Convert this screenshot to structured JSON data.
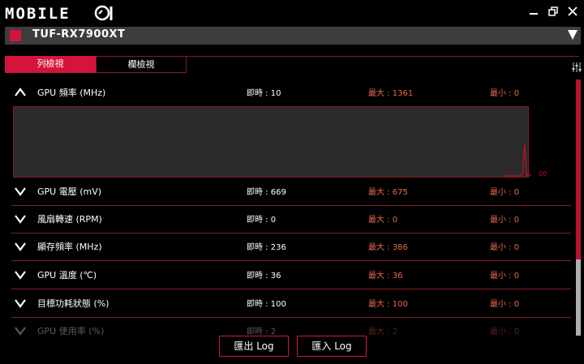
{
  "app": {
    "logo_text": "MOBILE01"
  },
  "device": {
    "name": "TUF-RX7900XT"
  },
  "tabs": [
    {
      "label": "列檢視"
    },
    {
      "label": "欄檢視"
    }
  ],
  "sensors": [
    {
      "label": "GPU 頻率 (MHz)",
      "current": "即時 : 10",
      "max": "最大 : 1361",
      "min": "最小 : 0",
      "expanded": true
    },
    {
      "label": "GPU 電壓 (mV)",
      "current": "即時 : 669",
      "max": "最大 : 675",
      "min": "最小 : 0"
    },
    {
      "label": "風扇轉速 (RPM)",
      "current": "即時 : 0",
      "max": "最大 : 0",
      "min": "最小 : 0"
    },
    {
      "label": "顯存頻率 (MHz)",
      "current": "即時 : 236",
      "max": "最大 : 386",
      "min": "最小 : 0"
    },
    {
      "label": "GPU 溫度 (℃)",
      "current": "即時 : 36",
      "max": "最大 : 36",
      "min": "最小 : 0"
    },
    {
      "label": "目標功耗狀態 (%)",
      "current": "即時 : 100",
      "max": "最大 : 100",
      "min": "最小 : 0"
    },
    {
      "label": "GPU 使用率 (%)",
      "current": "即時 : 2",
      "max": "最大 : 2",
      "min": "最小 : 0"
    }
  ],
  "buttons": {
    "export": "匯出 Log",
    "import": "匯入 Log"
  },
  "colors": {
    "accent": "#d4143c",
    "border": "#8a1a2e",
    "value_orange": "#e86a4a"
  }
}
